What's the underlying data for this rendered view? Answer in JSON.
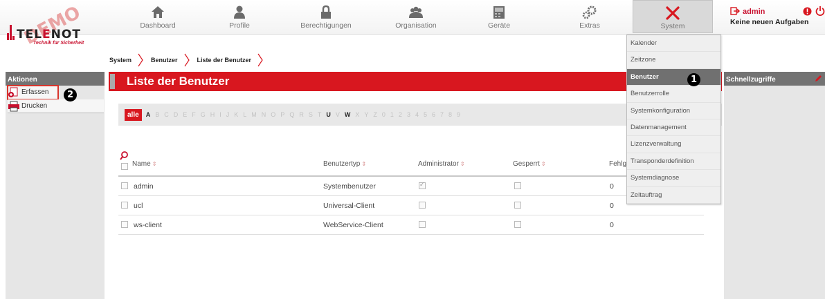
{
  "logo": {
    "brand_pre": "TEL",
    "brand_red": "E",
    "brand_post": "NOT",
    "tagline": "Technik für Sicherheit",
    "watermark": "DEMO"
  },
  "nav": [
    {
      "label": "Dashboard",
      "icon": "home-icon"
    },
    {
      "label": "Profile",
      "icon": "person-icon"
    },
    {
      "label": "Berechtigungen",
      "icon": "lock-icon"
    },
    {
      "label": "Organisation",
      "icon": "group-icon"
    },
    {
      "label": "Geräte",
      "icon": "device-icon"
    },
    {
      "label": "Extras",
      "icon": "gears-icon"
    },
    {
      "label": "System",
      "icon": "tools-icon",
      "active": true
    }
  ],
  "user": {
    "name": "admin",
    "tasks": "Keine neuen Aufgaben"
  },
  "breadcrumb": [
    "System",
    "Benutzer",
    "Liste der Benutzer"
  ],
  "sidebar": {
    "header": "Aktionen",
    "items": [
      {
        "label": "Erfassen",
        "icon": "add-document-icon"
      },
      {
        "label": "Drucken",
        "icon": "printer-icon"
      }
    ]
  },
  "markers": {
    "one": "1",
    "two": "2"
  },
  "main": {
    "title": "Liste der Benutzer",
    "alphabet_all": "alle",
    "letters": [
      "A",
      "B",
      "C",
      "D",
      "E",
      "F",
      "G",
      "H",
      "I",
      "J",
      "K",
      "L",
      "M",
      "N",
      "O",
      "P",
      "Q",
      "R",
      "S",
      "T",
      "U",
      "V",
      "W",
      "X",
      "Y",
      "Z",
      "0",
      "1",
      "2",
      "3",
      "4",
      "5",
      "6",
      "7",
      "8",
      "9"
    ],
    "active_letters": [
      "A",
      "U",
      "W"
    ],
    "columns": [
      "Name",
      "Benutzertyp",
      "Administrator",
      "Gesperrt",
      "Fehlges"
    ],
    "sort_glyph": "⇕",
    "rows": [
      {
        "name": "admin",
        "type": "Systembenutzer",
        "admin": true,
        "locked": false,
        "failed": "0"
      },
      {
        "name": "ucl",
        "type": "Universal-Client",
        "admin": false,
        "locked": false,
        "failed": "0"
      },
      {
        "name": "ws-client",
        "type": "WebService-Client",
        "admin": false,
        "locked": false,
        "failed": "0"
      }
    ]
  },
  "system_menu": [
    "Kalender",
    "Zeitzone",
    "Benutzer",
    "Benutzerrolle",
    "Systemkonfiguration",
    "Datenmanagement",
    "Lizenzverwaltung",
    "Transponderdefinition",
    "Systemdiagnose",
    "Zeitauftrag"
  ],
  "system_menu_active": "Benutzer",
  "right_sidebar": {
    "header": "Schnellzugriffe"
  },
  "colors": {
    "accent": "#d8171f",
    "header_gray": "#737373"
  }
}
